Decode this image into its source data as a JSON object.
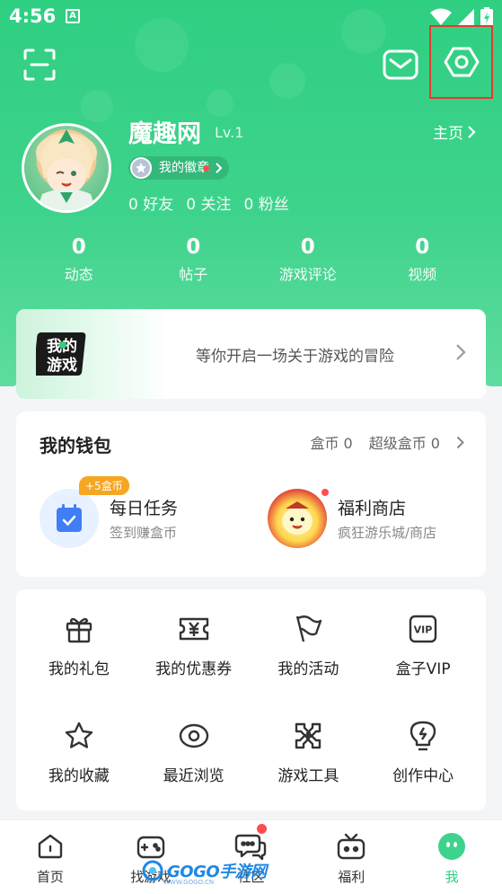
{
  "status_bar": {
    "time": "4:56",
    "notification_badge": "A"
  },
  "profile": {
    "username": "魔趣网",
    "level": "Lv.1",
    "homepage_label": "主页",
    "badge_label": "我的徽章",
    "friends": "0 好友",
    "following": "0 关注",
    "followers": "0 粉丝"
  },
  "stats": [
    {
      "value": "0",
      "label": "动态"
    },
    {
      "value": "0",
      "label": "帖子"
    },
    {
      "value": "0",
      "label": "游戏评论"
    },
    {
      "value": "0",
      "label": "视频"
    }
  ],
  "adventure": {
    "logo_text": "我的游戏",
    "prompt": "等你开启一场关于游戏的冒险"
  },
  "wallet": {
    "title": "我的钱包",
    "coins": "盒币 0",
    "super_coins": "超级盒币 0",
    "daily_task": {
      "title": "每日任务",
      "subtitle": "签到赚盒币",
      "bonus": "+5盒币"
    },
    "shop": {
      "title": "福利商店",
      "subtitle": "疯狂游乐城/商店"
    }
  },
  "grid": [
    {
      "label": "我的礼包",
      "icon": "gift-icon"
    },
    {
      "label": "我的优惠券",
      "icon": "coupon-icon"
    },
    {
      "label": "我的活动",
      "icon": "flag-icon"
    },
    {
      "label": "盒子VIP",
      "icon": "vip-icon"
    },
    {
      "label": "我的收藏",
      "icon": "star-icon"
    },
    {
      "label": "最近浏览",
      "icon": "eye-icon"
    },
    {
      "label": "游戏工具",
      "icon": "tools-icon"
    },
    {
      "label": "创作中心",
      "icon": "lightbulb-icon"
    }
  ],
  "tabbar": [
    {
      "label": "首页",
      "icon": "home-icon"
    },
    {
      "label": "找游戏",
      "icon": "gamepad-icon"
    },
    {
      "label": "社区",
      "icon": "chat-icon"
    },
    {
      "label": "福利",
      "icon": "gift-tv-icon"
    },
    {
      "label": "我",
      "icon": "me-icon"
    }
  ],
  "watermark": {
    "text": "GOGO手游网",
    "sub": "WWW.GOGO.CN"
  },
  "colors": {
    "brand_green": "#2fcf82",
    "highlight_red": "#e23b2e",
    "badge_orange": "#f6a623"
  }
}
